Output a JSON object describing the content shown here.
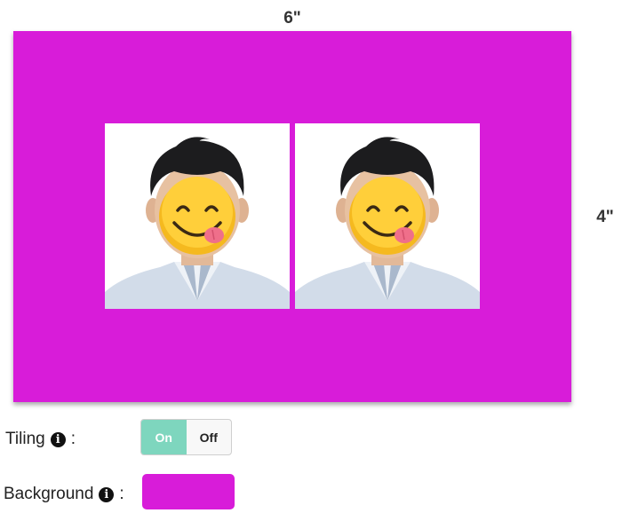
{
  "dimensions": {
    "width_label": "6\"",
    "height_label": "4\""
  },
  "canvas": {
    "background_color": "#D81CD9",
    "tiles": [
      {
        "content": "portrait-with-smiley-emoji"
      },
      {
        "content": "portrait-with-smiley-emoji"
      }
    ]
  },
  "tiling": {
    "label": "Tiling",
    "colon": ":",
    "info_icon": "info-icon",
    "on_label": "On",
    "off_label": "Off",
    "selected": "On",
    "on_color": "#7ED6BE"
  },
  "background": {
    "label": "Background",
    "colon": ":",
    "info_icon": "info-icon",
    "color": "#D81CD9"
  }
}
